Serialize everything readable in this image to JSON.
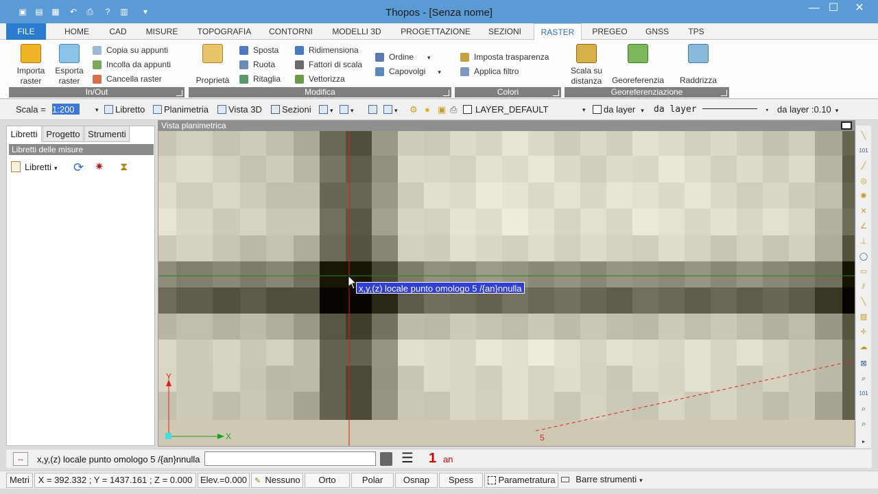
{
  "window": {
    "title": "Thopos - [Senza nome]",
    "min": "—",
    "max": "☐",
    "close": "✕"
  },
  "ribbon_tabs": [
    "FILE",
    "HOME",
    "CAD",
    "MISURE",
    "TOPOGRAFIA",
    "CONTORNI",
    "MODELLI 3D",
    "PROGETTAZIONE",
    "SEZIONI",
    "RASTER",
    "PREGEO",
    "GNSS",
    "TPS"
  ],
  "active_tab": "RASTER",
  "ribbon": {
    "inout": {
      "label": "In/Out",
      "importa": "Importa raster",
      "esporta": "Esporta raster",
      "copia": "Copia su appunti",
      "incolla": "Incolla da appunti",
      "cancella": "Cancella raster"
    },
    "modifica": {
      "label": "Modifica",
      "proprieta": "Proprietà",
      "sposta": "Sposta",
      "ruota": "Ruota",
      "ritaglia": "Ritaglia",
      "ridimensiona": "Ridimensiona",
      "fattori": "Fattori di scala",
      "vettorizza": "Vettorizza",
      "ordine": "Ordine",
      "capovolgi": "Capovolgi"
    },
    "colori": {
      "label": "Colori",
      "trasparenza": "Imposta trasparenza",
      "filtro": "Applica filtro"
    },
    "georef": {
      "label": "Georeferenziazione",
      "scala": "Scala su distanza",
      "georeferenzia": "Georeferenzia",
      "raddrizza": "Raddrizza"
    }
  },
  "toolbar": {
    "scala_label": "Scala =",
    "scala_value": "1:200",
    "libretto": "Libretto",
    "planimetria": "Planimetria",
    "vista3d": "Vista 3D",
    "sezioni": "Sezioni",
    "layer": "LAYER_DEFAULT",
    "color": "da layer",
    "linetype": "da layer",
    "lineweight": "da layer :0.10"
  },
  "left_panel": {
    "tabs": [
      "Libretti",
      "Progetto",
      "Strumenti"
    ],
    "header": "Libretti delle misure",
    "libretti_btn": "Libretti"
  },
  "viewport": {
    "title": "Vista planimetrica",
    "axis_y": "Y",
    "axis_x": "X",
    "point_label": "5",
    "tooltip": "x,y,(z) locale punto omologo 5 /{an}nnulla"
  },
  "command": {
    "prompt": "x,y,(z) locale punto omologo 5 /{an}nnulla",
    "input_value": "",
    "count": "1",
    "unit": "an"
  },
  "status": {
    "units": "Metri",
    "coords": "X = 392.332 ; Y = 1437.161 ; Z = 0.000",
    "elev": "Elev.=0.000",
    "snap_mode": "Nessuno",
    "orto": "Orto",
    "polar": "Polar",
    "osnap": "Osnap",
    "spess": "Spess",
    "parametratura": "Parametratura",
    "barre": "Barre strumenti"
  },
  "colors": {
    "titlebar": "#5b9bd5",
    "file_tab": "#2b7bd0",
    "accent_red": "#cc0000",
    "axis_green": "#1aa31a",
    "tooltip_bg": "#2f3fd8"
  }
}
